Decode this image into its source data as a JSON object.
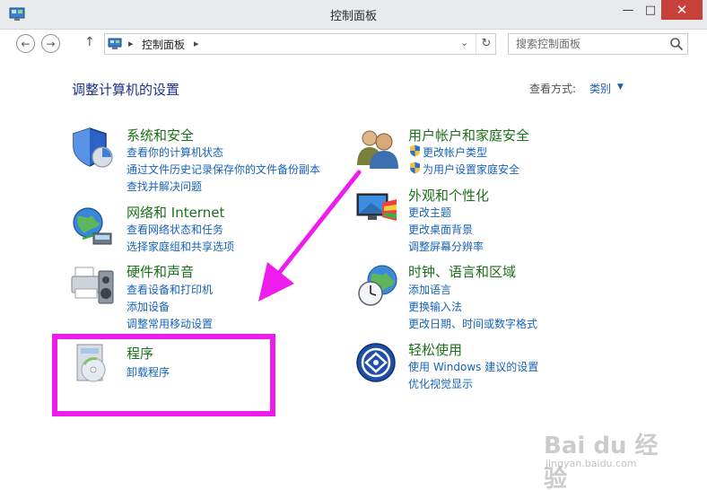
{
  "window": {
    "title": "控制面板",
    "minimize": "—",
    "maximize": "□",
    "close": "✕"
  },
  "nav": {
    "back": "←",
    "forward": "→",
    "up": "↑"
  },
  "address": {
    "crumb": "控制面板",
    "separator": "▸",
    "dropdown": "⌄",
    "refresh": "↻"
  },
  "search": {
    "placeholder": "搜索控制面板"
  },
  "main": {
    "heading": "调整计算机的设置",
    "view_label": "查看方式:",
    "view_value": "类别",
    "view_caret": "▼"
  },
  "categories": [
    {
      "title": "系统和安全",
      "icon": "shield-icon",
      "links": [
        "查看你的计算机状态",
        "通过文件历史记录保存你的文件备份副本",
        "查找并解决问题"
      ]
    },
    {
      "title": "网络和 Internet",
      "icon": "network-globe-icon",
      "links": [
        "查看网络状态和任务",
        "选择家庭组和共享选项"
      ]
    },
    {
      "title": "硬件和声音",
      "icon": "printer-speaker-icon",
      "links": [
        "查看设备和打印机",
        "添加设备",
        "调整常用移动设置"
      ]
    },
    {
      "title": "程序",
      "icon": "programs-disc-icon",
      "links": [
        "卸载程序"
      ]
    },
    {
      "title": "用户帐户和家庭安全",
      "icon": "users-icon",
      "links": [
        "更改帐户类型",
        "为用户设置家庭安全"
      ]
    },
    {
      "title": "外观和个性化",
      "icon": "monitor-palette-icon",
      "links": [
        "更改主题",
        "更改桌面背景",
        "调整屏幕分辨率"
      ]
    },
    {
      "title": "时钟、语言和区域",
      "icon": "clock-globe-icon",
      "links": [
        "添加语言",
        "更换输入法",
        "更改日期、时间或数字格式"
      ]
    },
    {
      "title": "轻松使用",
      "icon": "ease-of-access-icon",
      "links": [
        "使用 Windows 建议的设置",
        "优化视觉显示"
      ]
    }
  ],
  "watermark": {
    "main": "Bai du 经验",
    "sub": "jingyan.baidu.com"
  },
  "colors": {
    "title_green": "#1b6f1b",
    "link_blue": "#1763b8",
    "heading_blue": "#1e3287",
    "annotation_magenta": "#ee1dee",
    "close_red": "#c7413a"
  }
}
